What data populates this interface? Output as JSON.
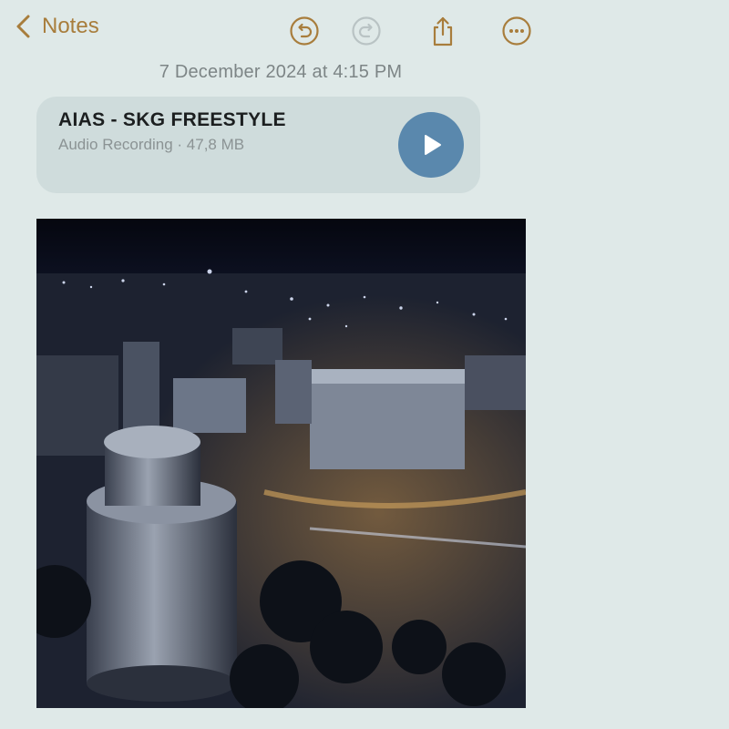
{
  "nav": {
    "back_label": "Notes"
  },
  "toolbar": {
    "undo_icon": "undo-icon",
    "redo_icon": "redo-icon",
    "share_icon": "share-icon",
    "more_icon": "more-icon"
  },
  "note": {
    "date": "7 December 2024 at 4:15 PM",
    "attachment": {
      "title": "AIAS - SKG FREESTYLE",
      "meta": "Audio Recording · 47,8 MB"
    }
  },
  "colors": {
    "accent": "#a87d3c",
    "background": "#dfe9e8",
    "card": "#cfdcdc",
    "play": "#5a88ad"
  }
}
